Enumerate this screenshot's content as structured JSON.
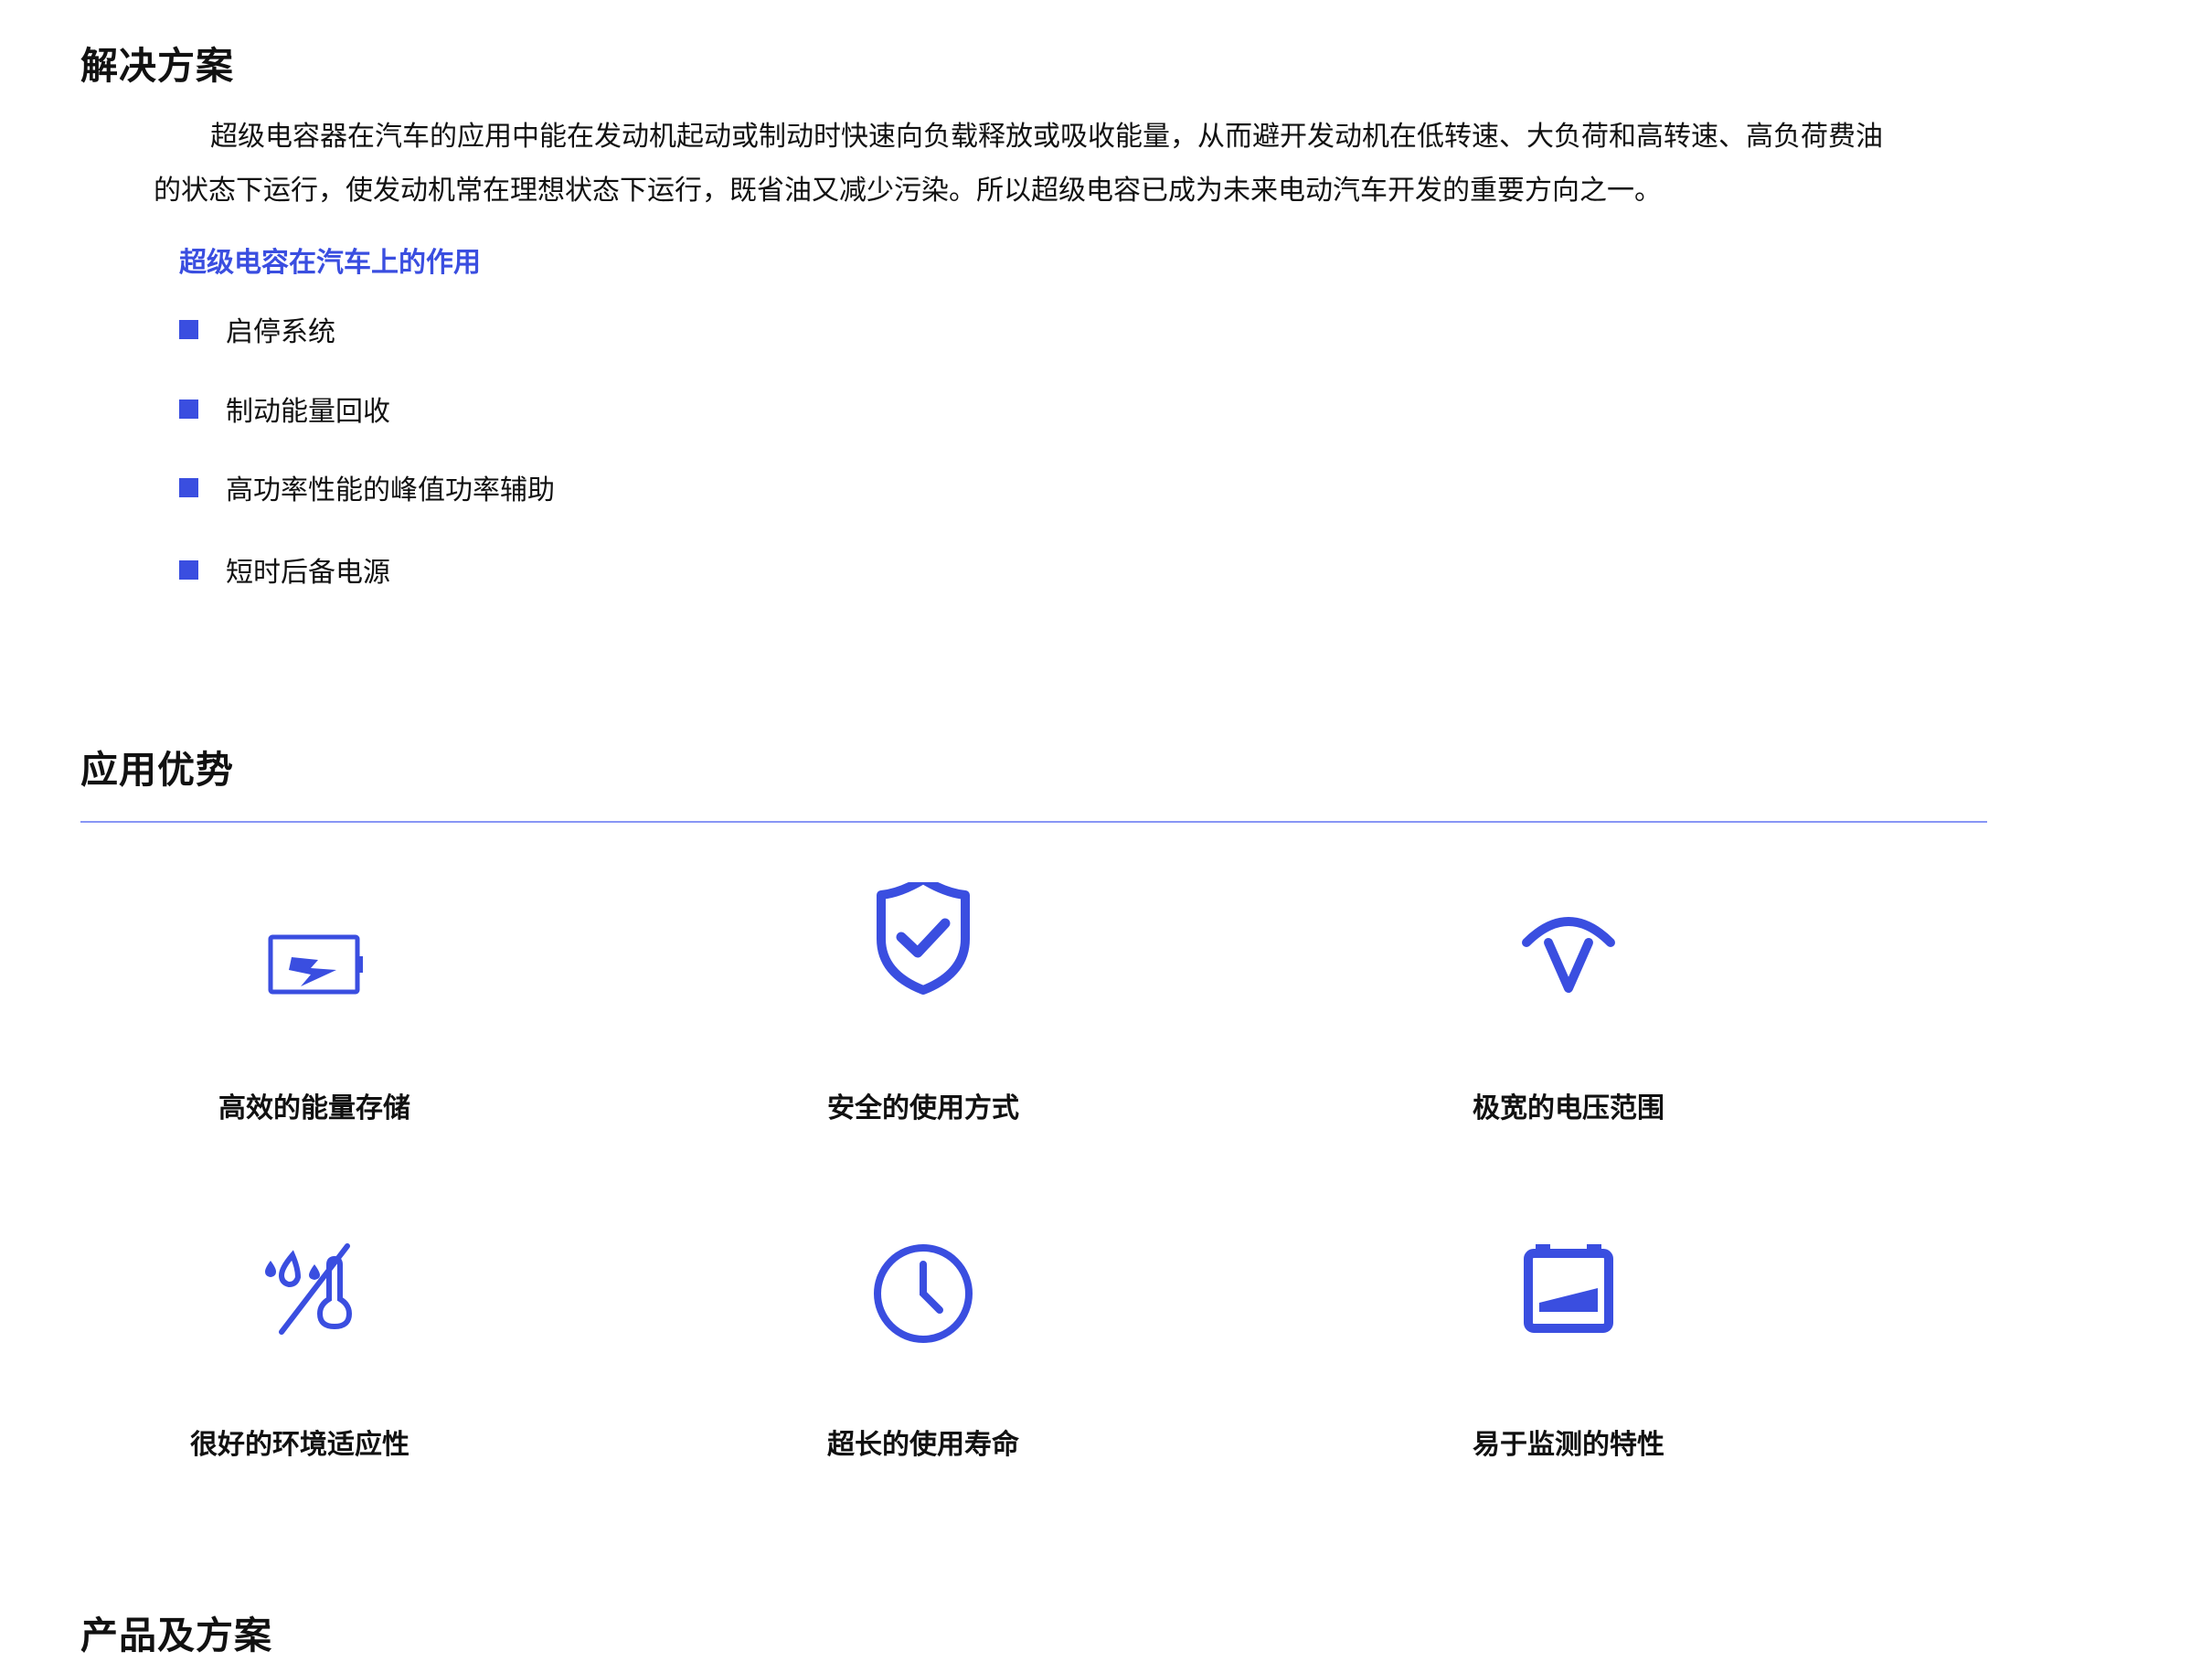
{
  "solution": {
    "title": "解决方案",
    "intro": "超级电容器在汽车的应用中能在发动机起动或制动时快速向负载释放或吸收能量，从而避开发动机在低转速、大负荷和高转速、高负荷费油的状态下运行，使发动机常在理想状态下运行，既省油又减少污染。所以超级电容已成为未来电动汽车开发的重要方向之一。",
    "roles_title": "超级电容在汽车上的作用",
    "roles": [
      "启停系统",
      "制动能量回收",
      "高功率性能的峰值功率辅助",
      "短时后备电源"
    ]
  },
  "advantages": {
    "title": "应用优势",
    "items": [
      {
        "label": "高效的能量存储",
        "icon": "battery-bolt-icon"
      },
      {
        "label": "安全的使用方式",
        "icon": "shield-check-icon"
      },
      {
        "label": "极宽的电压范围",
        "icon": "voltage-gauge-icon"
      },
      {
        "label": "很好的环境适应性",
        "icon": "humidity-temperature-icon"
      },
      {
        "label": "超长的使用寿命",
        "icon": "clock-icon"
      },
      {
        "label": "易于监测的特性",
        "icon": "battery-level-icon"
      }
    ]
  },
  "products": {
    "title": "产品及方案"
  },
  "colors": {
    "accent": "#3a4ee0",
    "divider": "#8896f5",
    "text": "#111111"
  }
}
